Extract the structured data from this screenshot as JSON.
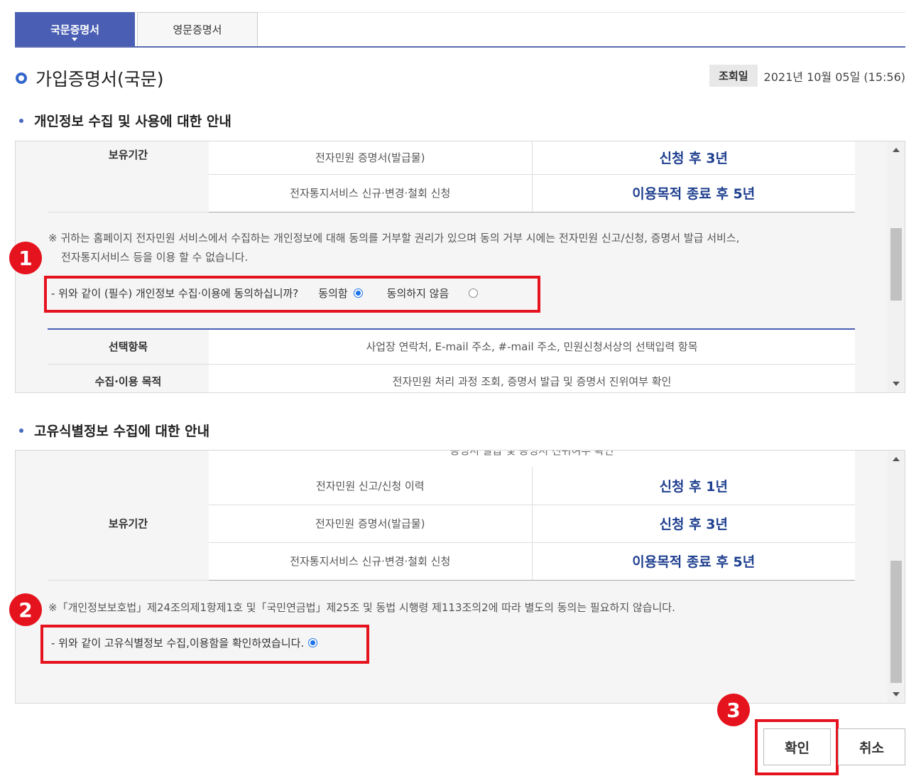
{
  "tabs": [
    {
      "label": "국문증명서",
      "active": true
    },
    {
      "label": "영문증명서",
      "active": false
    }
  ],
  "page_title": "가입증명서(국문)",
  "lookup": {
    "label": "조회일",
    "date": "2021년 10월 05일 (15:56)"
  },
  "section1": {
    "heading": "개인정보 수집 및 사용에 대한 안내",
    "retention_label": "보유기간",
    "retention_rows": [
      {
        "item": "전자민원 증명서(발급물)",
        "period": "신청 후 3년"
      },
      {
        "item": "전자통지서비스 신규·변경·철회 신청",
        "period": "이용목적 종료 후 5년"
      }
    ],
    "note_line1": "※ 귀하는 홈페이지 전자민원 서비스에서 수집하는 개인정보에 대해 동의를 거부할 권리가 있으며 동의 거부 시에는 전자민원 신고/신청, 증명서 발급 서비스,",
    "note_line2": "전자통지서비스 등을 이용 할 수 없습니다.",
    "consent_question": "- 위와 같이 (필수) 개인정보 수집·이용에 동의하십니까?",
    "consent_yes": "동의함",
    "consent_no": "동의하지 않음",
    "consent_selected": "yes",
    "optional_rows": [
      {
        "label": "선택항목",
        "value": "사업장 연락처, E-mail 주소, #-mail 주소, 민원신청서상의 선택입력 항목"
      },
      {
        "label": "수집·이용 목적",
        "value": "전자민원 처리 과정 조회, 증명서 발급 및 증명서 진위여부 확인"
      }
    ]
  },
  "section2": {
    "heading": "고유식별정보 수집에 대한 안내",
    "cut_text": "증명서 발급 및 증명서 진위여부 확인",
    "retention_label": "보유기간",
    "retention_rows": [
      {
        "item": "전자민원 신고/신청 이력",
        "period": "신청 후 1년"
      },
      {
        "item": "전자민원 증명서(발급물)",
        "period": "신청 후 3년"
      },
      {
        "item": "전자통지서비스 신규·변경·철회 신청",
        "period": "이용목적 종료 후 5년"
      }
    ],
    "note": "※「개인정보보호법」제24조의제1항제1호 및「국민연금법」제25조 및 동법 시행령 제113조의2에 따라 별도의 동의는 필요하지 않습니다.",
    "confirm_text": "- 위와 같이 고유식별정보 수집,이용함을 확인하였습니다.",
    "confirm_selected": true
  },
  "badges": [
    "1",
    "2",
    "3"
  ],
  "buttons": {
    "confirm": "확인",
    "cancel": "취소"
  },
  "colors": {
    "accent": "#4a5fb4",
    "highlight": "#e5131e",
    "value_text": "#1f3f8f"
  }
}
